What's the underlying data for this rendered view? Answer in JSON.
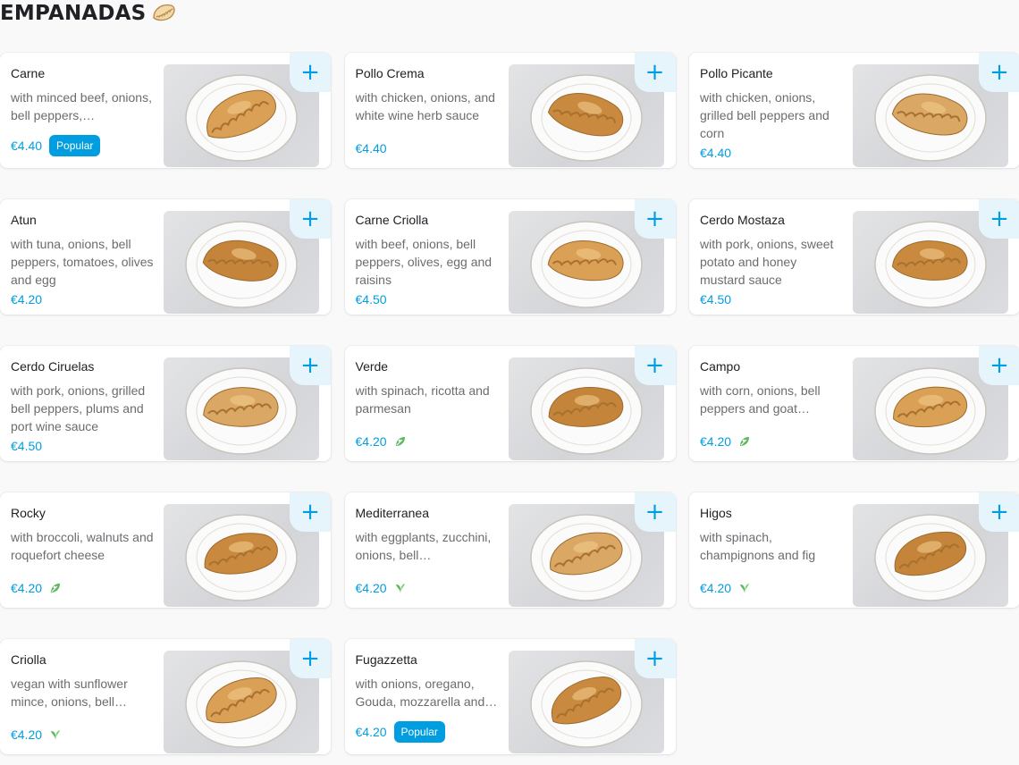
{
  "section": {
    "title": "EMPANADAS",
    "icon": "empanada-icon"
  },
  "colors": {
    "accent": "#009de0",
    "veg": "#4caf50"
  },
  "items": [
    {
      "name": "Carne",
      "description": "with minced beef, onions, bell peppers,…",
      "price": "€4.40",
      "badge": "Popular",
      "diet": null
    },
    {
      "name": "Pollo Crema",
      "description": "with chicken, onions, and white wine herb sauce",
      "price": "€4.40",
      "badge": null,
      "diet": null
    },
    {
      "name": "Pollo Picante",
      "description": "with chicken, onions, grilled bell peppers and corn",
      "price": "€4.40",
      "badge": null,
      "diet": null
    },
    {
      "name": "Atun",
      "description": "with tuna, onions, bell peppers, tomatoes, olives and egg",
      "price": "€4.20",
      "badge": null,
      "diet": null
    },
    {
      "name": "Carne Criolla",
      "description": "with beef, onions, bell peppers, olives, egg and raisins",
      "price": "€4.50",
      "badge": null,
      "diet": null
    },
    {
      "name": "Cerdo Mostaza",
      "description": "with pork, onions, sweet potato and honey mustard sauce",
      "price": "€4.50",
      "badge": null,
      "diet": null
    },
    {
      "name": "Cerdo Ciruelas",
      "description": "with pork, onions, grilled bell peppers, plums and port wine sauce",
      "price": "€4.50",
      "badge": null,
      "diet": null
    },
    {
      "name": "Verde",
      "description": "with spinach, ricotta and parmesan",
      "price": "€4.20",
      "badge": null,
      "diet": "vegetarian-icon"
    },
    {
      "name": "Campo",
      "description": "with corn, onions, bell peppers and goat…",
      "price": "€4.20",
      "badge": null,
      "diet": "vegetarian-icon"
    },
    {
      "name": "Rocky",
      "description": "with broccoli, walnuts and roquefort cheese",
      "price": "€4.20",
      "badge": null,
      "diet": "vegetarian-icon"
    },
    {
      "name": "Mediterranea",
      "description": "with eggplants, zucchini, onions, bell…",
      "price": "€4.20",
      "badge": null,
      "diet": "vegan-icon"
    },
    {
      "name": "Higos",
      "description": "with spinach, champignons and fig",
      "price": "€4.20",
      "badge": null,
      "diet": "vegan-icon"
    },
    {
      "name": "Criolla",
      "description": "vegan with sunflower mince, onions, bell…",
      "price": "€4.20",
      "badge": null,
      "diet": "vegan-icon"
    },
    {
      "name": "Fugazzetta",
      "description": "with onions, oregano, Gouda, mozzarella and…",
      "price": "€4.20",
      "badge": "Popular",
      "diet": null
    }
  ],
  "add_label": "+"
}
